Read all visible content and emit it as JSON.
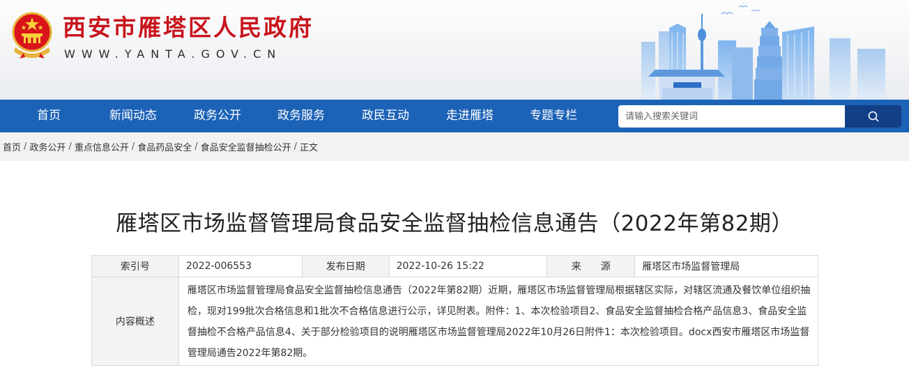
{
  "header": {
    "site_title": "西安市雁塔区人民政府",
    "site_url": "WWW.YANTA.GOV.CN",
    "brand_color": "#c8141c"
  },
  "nav": {
    "items": [
      "首页",
      "新闻动态",
      "政务公开",
      "政务服务",
      "政民互动",
      "走进雁塔",
      "专题专栏"
    ],
    "background": "#1c62b6",
    "search_placeholder": "请输入搜索关键词"
  },
  "breadcrumb": {
    "items": [
      "首页",
      "政务公开",
      "重点信息公开",
      "食品药品安全",
      "食品安全监督抽检公开",
      "正文"
    ]
  },
  "article": {
    "title": "雁塔区市场监督管理局食品安全监督抽检信息通告（2022年第82期）"
  },
  "info": {
    "index_label": "索引号",
    "index_value": "2022-006553",
    "date_label": "发布日期",
    "date_value": "2022-10-26 15:22",
    "source_label": "来　　源",
    "source_value": "雁塔区市场监督管理局",
    "summary_label": "内容概述",
    "summary_value": "雁塔区市场监督管理局食品安全监督抽检信息通告（2022年第82期）近期，雁塔区市场监督管理局根据辖区实际，对辖区流通及餐饮单位组织抽检，现对199批次合格信息和1批次不合格信息进行公示，详见附表。附件：1、本次检验项目2、食品安全监督抽检合格产品信息3、食品安全监督抽检不合格产品信息4、关于部分检验项目的说明雁塔区市场监督管理局2022年10月26日附件1：本次检验项目。docx西安市雁塔区市场监督管理局通告2022年第82期。"
  }
}
